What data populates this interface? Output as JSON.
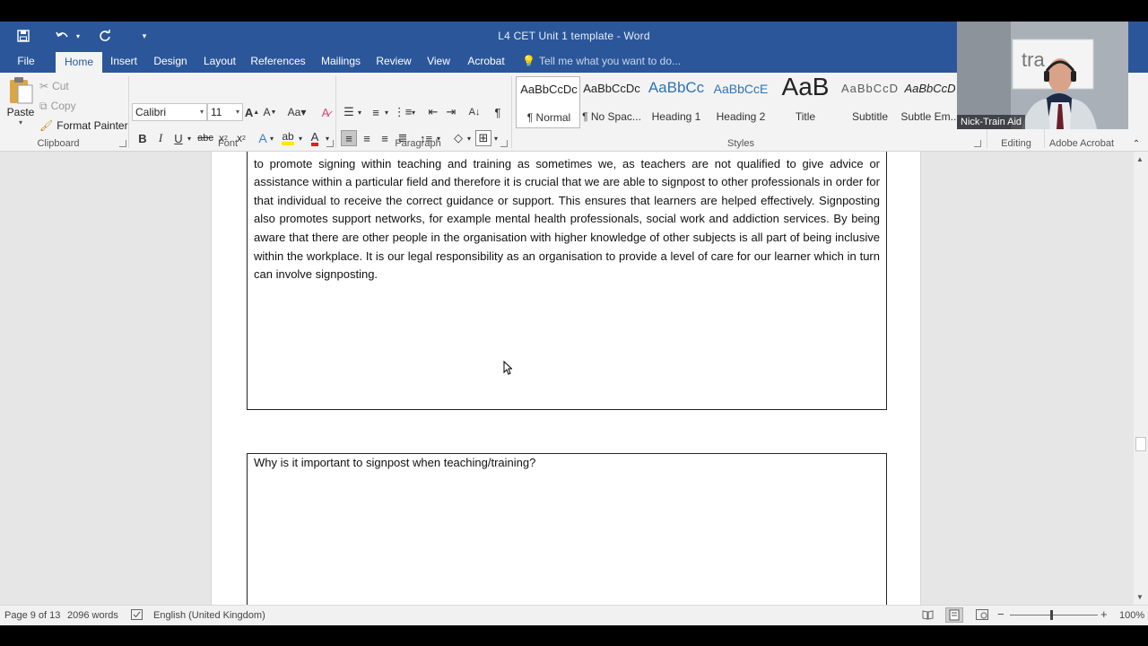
{
  "titlebar": {
    "title": "L4 CET Unit 1 template - Word"
  },
  "tabs": [
    {
      "label": "File"
    },
    {
      "label": "Home"
    },
    {
      "label": "Insert"
    },
    {
      "label": "Design"
    },
    {
      "label": "Layout"
    },
    {
      "label": "References"
    },
    {
      "label": "Mailings"
    },
    {
      "label": "Review"
    },
    {
      "label": "View"
    },
    {
      "label": "Acrobat"
    }
  ],
  "tellme": "Tell me what you want to do...",
  "clipboard": {
    "paste": "Paste",
    "cut": "Cut",
    "copy": "Copy",
    "format_painter": "Format Painter",
    "label": "Clipboard"
  },
  "font": {
    "name": "Calibri",
    "size": "11",
    "label": "Font"
  },
  "paragraph": {
    "label": "Paragraph"
  },
  "styles": {
    "label": "Styles",
    "items": [
      {
        "preview": "AaBbCcDc",
        "name": "¶ Normal"
      },
      {
        "preview": "AaBbCcDc",
        "name": "¶ No Spac..."
      },
      {
        "preview": "AaBbCc",
        "name": "Heading 1"
      },
      {
        "preview": "AaBbCcE",
        "name": "Heading 2"
      },
      {
        "preview": "AaB",
        "name": "Title"
      },
      {
        "preview": "AaBbCcD",
        "name": "Subtitle"
      },
      {
        "preview": "AaBbCcD",
        "name": "Subtle Em..."
      }
    ]
  },
  "editing": {
    "label": "Editing"
  },
  "adobe": {
    "label": "Adobe Acrobat"
  },
  "document": {
    "paragraph1": "Signposting refers to the act of guiding individuals to other sources of services for help, support or advice. It is important to promote signing within teaching and training as sometimes we, as teachers are not qualified to give advice or assistance within a particular field and therefore it is crucial that we are able to signpost to other professionals in order for that individual to receive the correct guidance or support. This ensures that learners are helped effectively. Signposting also promotes support networks, for example mental health professionals, social work and addiction services. By being aware that there are other people in the organisation with higher knowledge of other subjects is all part of being inclusive within the workplace. It is our legal responsibility as an organisation to provide a level of care for our learner which in turn can involve signposting.",
    "question2": "Why is it important to signpost when teaching/training?"
  },
  "statusbar": {
    "page": "Page 9 of 13",
    "words": "2096 words",
    "language": "English (United Kingdom)",
    "zoom": "100%"
  },
  "webcam": {
    "name": "Nick-Train Aid"
  },
  "colors": {
    "accent": "#2b579a",
    "ribbon": "#f3f3f3",
    "docbg": "#e6e6e6"
  }
}
